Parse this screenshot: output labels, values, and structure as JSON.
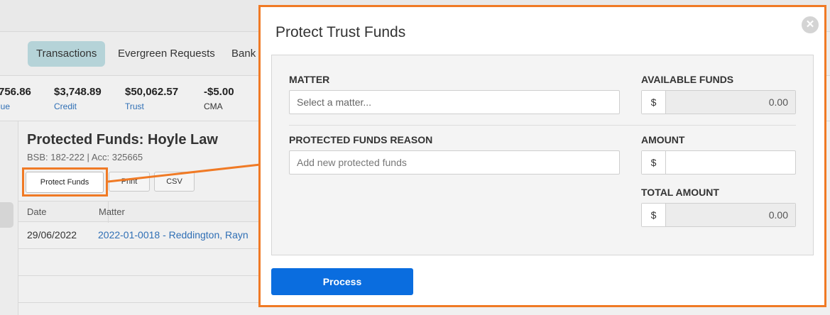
{
  "tabs": [
    {
      "label": "Transactions",
      "active": true
    },
    {
      "label": "Evergreen Requests",
      "active": false
    },
    {
      "label": "Bank",
      "active": false
    }
  ],
  "stats": [
    {
      "value": "756.86",
      "label": "lue"
    },
    {
      "value": "$3,748.89",
      "label": "Credit"
    },
    {
      "value": "$50,062.57",
      "label": "Trust"
    },
    {
      "value": "-$5.00",
      "label": "CMA"
    }
  ],
  "page": {
    "title": "Protected Funds: Hoyle Law",
    "subtitle": "BSB: 182-222 | Acc: 325665",
    "buttons": {
      "protect_funds": "Protect Funds",
      "print": "Print",
      "csv": "CSV"
    }
  },
  "table": {
    "columns": [
      "Date",
      "Matter"
    ],
    "rows": [
      {
        "date": "29/06/2022",
        "matter": "2022-01-0018 - Reddington, Rayn"
      }
    ]
  },
  "modal": {
    "title": "Protect Trust Funds",
    "close_icon": "close-icon",
    "matter_label": "MATTER",
    "matter_placeholder": "Select a matter...",
    "available_label": "AVAILABLE FUNDS",
    "available_currency": "$",
    "available_value": "0.00",
    "reason_label": "PROTECTED FUNDS REASON",
    "reason_placeholder": "Add new protected funds",
    "amount_label": "AMOUNT",
    "amount_currency": "$",
    "amount_value": "",
    "total_label": "TOTAL AMOUNT",
    "total_currency": "$",
    "total_value": "0.00",
    "process_label": "Process"
  },
  "colors": {
    "highlight": "#f07a25",
    "primary_button": "#0a6ddf",
    "active_tab": "#b5d3d8",
    "link": "#2f6fb5"
  }
}
